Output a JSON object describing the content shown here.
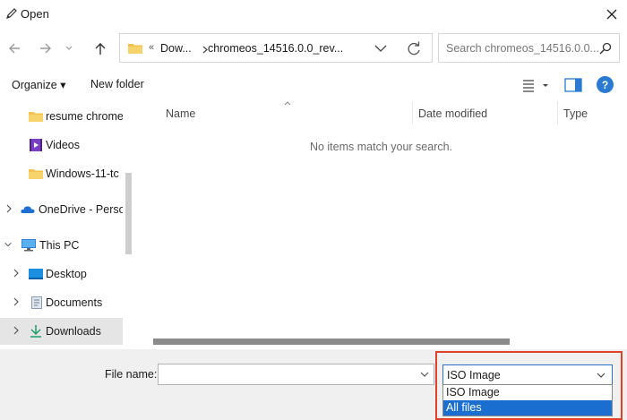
{
  "window": {
    "title": "Open"
  },
  "address": {
    "lead_separator": "«",
    "parts": [
      "Dow...",
      "chromeos_14516.0.0_rev..."
    ]
  },
  "search": {
    "placeholder": "Search chromeos_14516.0.0..."
  },
  "toolbar": {
    "organize_label": "Organize ▾",
    "new_folder_label": "New folder"
  },
  "sidebar": {
    "items": [
      {
        "label": "resume chrome",
        "icon": "folder-icon"
      },
      {
        "label": "Videos",
        "icon": "videos-icon"
      },
      {
        "label": "Windows-11-tc",
        "icon": "folder-icon"
      },
      {
        "label": "OneDrive - Perso",
        "icon": "onedrive-icon"
      },
      {
        "label": "This PC",
        "icon": "computer-icon"
      },
      {
        "label": "Desktop",
        "icon": "desktop-icon"
      },
      {
        "label": "Documents",
        "icon": "documents-icon"
      },
      {
        "label": "Downloads",
        "icon": "downloads-icon",
        "selected": true
      }
    ]
  },
  "columns": {
    "name": "Name",
    "date_modified": "Date modified",
    "type": "Type"
  },
  "content": {
    "empty_message": "No items match your search."
  },
  "footer": {
    "file_name_label": "File name:",
    "file_name_value": "",
    "file_type_selected": "ISO Image",
    "file_type_options": [
      "ISO Image",
      "All files"
    ],
    "file_type_highlighted": "All files"
  },
  "colors": {
    "accent": "#1a6ed0",
    "annotation": "#e0422a",
    "help": "#2a7ad2"
  }
}
